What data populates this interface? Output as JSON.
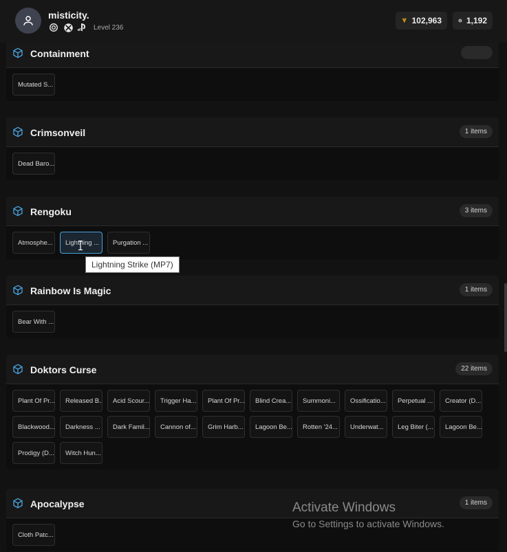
{
  "header": {
    "username": "misticity.",
    "level": "Level 236",
    "platforms": [
      "ubisoft-icon",
      "xbox-icon",
      "playstation-icon"
    ],
    "currency_money": "102,963",
    "currency_credits": "1,192"
  },
  "sections": [
    {
      "title": "Containment",
      "count": "",
      "items": [
        "Mutated S..."
      ]
    },
    {
      "title": "Crimsonveil",
      "count": "1 items",
      "items": [
        "Dead Baro..."
      ]
    },
    {
      "title": "Rengoku",
      "count": "3 items",
      "items": [
        "Atmosphe...",
        "Lightning ...",
        "Purgation ..."
      ]
    },
    {
      "title": "Rainbow Is Magic",
      "count": "1 items",
      "items": [
        "Bear With ..."
      ]
    },
    {
      "title": "Doktors Curse",
      "count": "22 items",
      "items": [
        "Plant Of Pr...",
        "Released B...",
        "Acid Scour...",
        "Trigger Ha...",
        "Plant Of Pr...",
        "Blind Crea...",
        "Summoni...",
        "Ossificatio...",
        "Perpetual ...",
        "Creator (D...",
        "Blackwood...",
        "Darkness ...",
        "Dark Famil...",
        "Cannon of...",
        "Grim Harb...",
        "Lagoon Be...",
        "Rotten '24...",
        "Underwat...",
        "Leg Biter (...",
        "Lagoon Be...",
        "Prodigy (D...",
        "Witch Hun..."
      ]
    },
    {
      "title": "Apocalypse",
      "count": "1 items",
      "items": [
        "Cloth Patc..."
      ]
    }
  ],
  "tooltip": "Lightning Strike (MP7)",
  "watermark": {
    "title": "Activate Windows",
    "subtitle": "Go to Settings to activate Windows."
  },
  "colors": {
    "accent": "#4aa3df",
    "background": "#121212",
    "gold": "#d4a017"
  }
}
